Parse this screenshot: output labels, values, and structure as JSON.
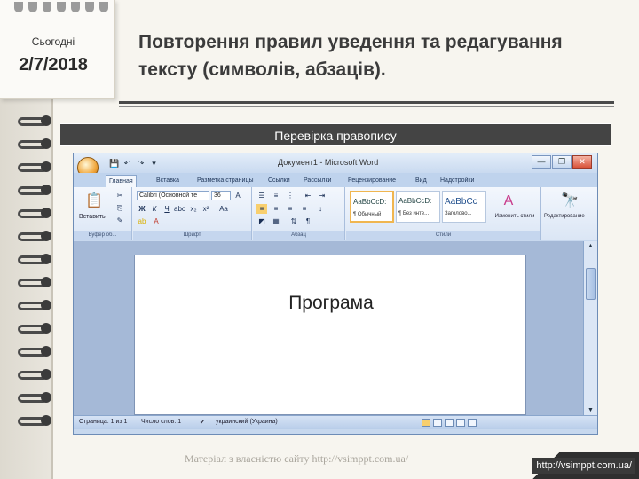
{
  "date_card": {
    "label": "Сьогодні",
    "value": "2/7/2018"
  },
  "title": "Повторення правил уведення та редагування тексту (символів, абзаців).",
  "subtitle": "Перевірка правопису",
  "word": {
    "window_title": "Документ1 - Microsoft Word",
    "quick_access": [
      "💾",
      "↶",
      "↷",
      "▾"
    ],
    "window_buttons": {
      "minimize": "—",
      "maximize": "❐",
      "close": "✕"
    },
    "tabs": [
      "Главная",
      "Вставка",
      "Разметка страницы",
      "Ссылки",
      "Рассылки",
      "Рецензирование",
      "Вид",
      "Надстройки"
    ],
    "clipboard": {
      "paste_label": "Вставить",
      "group_label": "Буфер об..."
    },
    "font": {
      "name": "Calibri (Основной те",
      "size": "36",
      "group_label": "Шрифт"
    },
    "paragraph": {
      "group_label": "Абзац"
    },
    "styles": {
      "tiles": [
        {
          "sample": "AaBbCcD:",
          "name": "¶ Обычный"
        },
        {
          "sample": "AaBbCcD:",
          "name": "¶ Без инте..."
        },
        {
          "sample": "AaBbCc",
          "name": "Заголово..."
        }
      ],
      "change_styles": "Изменить стили",
      "group_label": "Стили"
    },
    "editing": {
      "label": "Редактирование"
    },
    "document_text": "Програма",
    "status": {
      "page": "Страница: 1 из 1",
      "words": "Число слов: 1",
      "language": "украинский (Украина)"
    }
  },
  "footer_note": "Матеріал з власністю сайту http://vsimppt.com.ua/",
  "corner_url": "http://vsimppt.com.ua/",
  "colors": {
    "accent_dark": "#444444",
    "ribbon_blue": "#c7d8ee",
    "office_orange": "#f0a53a"
  }
}
